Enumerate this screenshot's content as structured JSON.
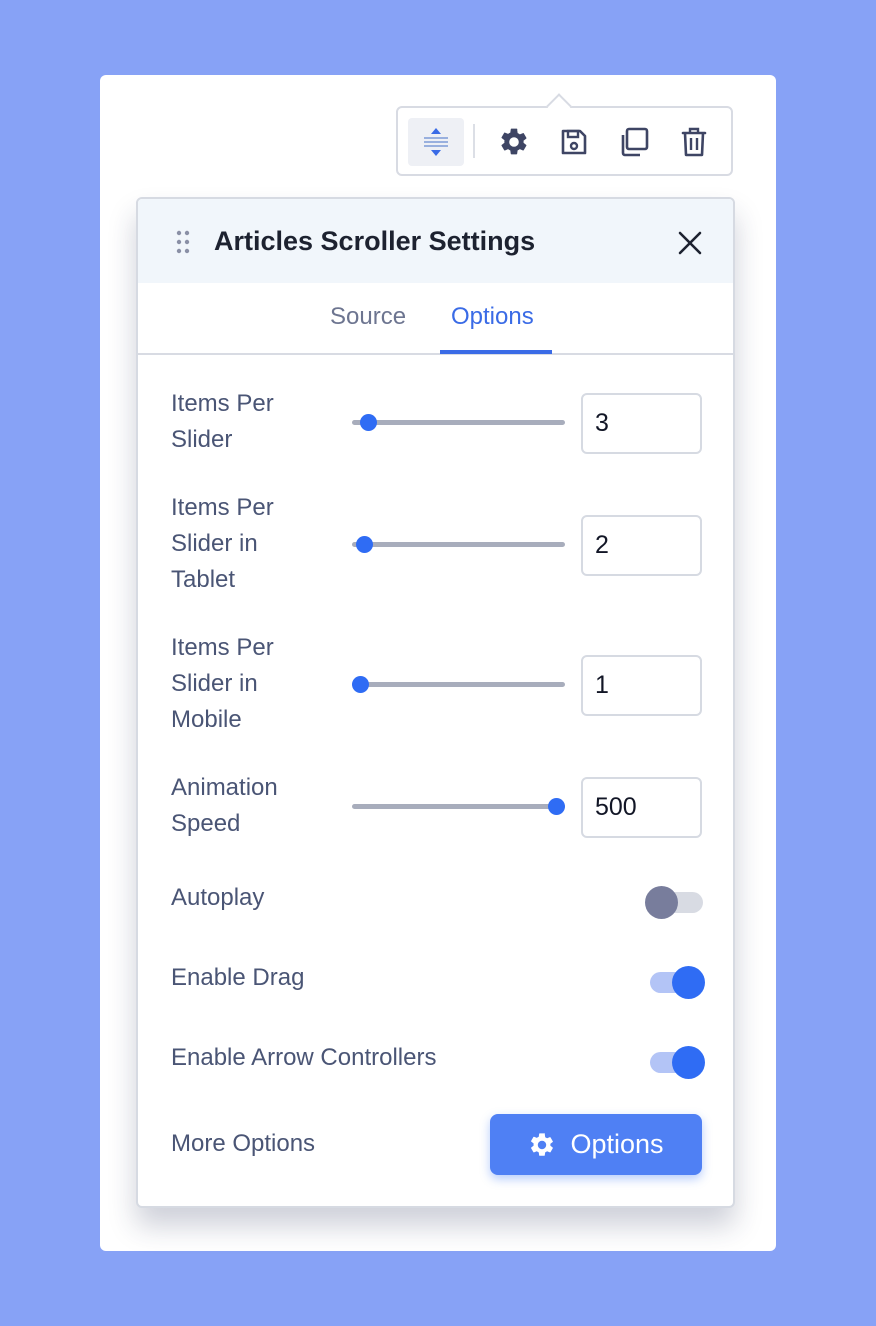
{
  "toolbar": {
    "buttons": [
      {
        "icon": "move-vertical-icon",
        "active": true
      },
      {
        "icon": "gear-icon"
      },
      {
        "icon": "save-icon"
      },
      {
        "icon": "duplicate-icon"
      },
      {
        "icon": "trash-icon"
      }
    ]
  },
  "panel": {
    "title": "Articles Scroller Settings",
    "tabs": [
      {
        "label": "Source",
        "active": false
      },
      {
        "label": "Options",
        "active": true
      }
    ],
    "sliders": [
      {
        "label_lines": [
          "Items Per",
          "Slider"
        ],
        "value": "3"
      },
      {
        "label_lines": [
          "Items Per",
          "Slider in",
          "Tablet"
        ],
        "value": "2"
      },
      {
        "label_lines": [
          "Items Per",
          "Slider in",
          "Mobile"
        ],
        "value": "1"
      },
      {
        "label_lines": [
          "Animation",
          "Speed"
        ],
        "value": "500"
      }
    ],
    "toggles": [
      {
        "label": "Autoplay",
        "on": false
      },
      {
        "label": "Enable Drag",
        "on": true
      },
      {
        "label": "Enable Arrow Controllers",
        "on": true
      }
    ],
    "more_options": {
      "label": "More Options",
      "button_label": "Options",
      "button_icon": "gear-icon"
    }
  },
  "colors": {
    "background": "#87a2f6",
    "accent": "#2f6cf4",
    "button": "#4f80f4",
    "tab_active": "#3a6be6"
  }
}
